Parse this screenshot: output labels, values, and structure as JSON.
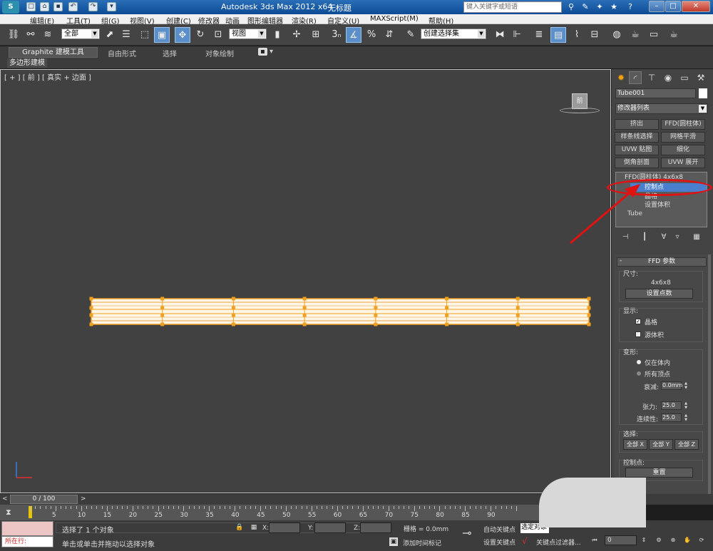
{
  "titlebar": {
    "app_title": "Autodesk 3ds Max  2012 x64",
    "file_name": "无标题",
    "search_placeholder": "键入关键字或短语",
    "logo_text": "S"
  },
  "menu": [
    "编辑(E)",
    "工具(T)",
    "组(G)",
    "视图(V)",
    "创建(C)",
    "修改器",
    "动画",
    "图形编辑器",
    "渲染(R)",
    "自定义(U)",
    "MAXScript(M)",
    "帮助(H)"
  ],
  "toolbar": {
    "selection_filter": "全部",
    "ref_coord": "视图",
    "snap_count": "3",
    "named_selection": "创建选择集"
  },
  "ribbon": {
    "tabs": [
      "Graphite 建模工具",
      "自由形式",
      "选择",
      "对象绘制"
    ],
    "sub_label": "多边形建模"
  },
  "viewport": {
    "label": "[ + ] [ 前 ] [ 真实 + 边面 ]",
    "viewcube_label": "前",
    "accent_color": "#f0a020"
  },
  "command_panel": {
    "object_name": "Tube001",
    "modifier_list": "修改器列表",
    "modifier_buttons": [
      "挤出",
      "FFD(圆柱体)",
      "样条线选择",
      "网格平滑",
      "UVW 贴图",
      "细化",
      "倒角剖面",
      "UVW 展开"
    ],
    "stack": {
      "modifier": "FFD(圆柱体) 4x6x8",
      "sub_items": [
        "控制点",
        "晶格",
        "设置体积"
      ],
      "base": "Tube",
      "selected": "控制点"
    }
  },
  "ffd_params": {
    "title": "FFD 参数",
    "dimensions_label": "尺寸:",
    "dimensions_value": "4x6x8",
    "set_points_button": "设置点数",
    "display_label": "显示:",
    "lattice": "晶格",
    "lattice_checked": true,
    "source_volume": "源体积",
    "source_volume_checked": false,
    "deform_label": "变形:",
    "only_in_volume": "仅在体内",
    "all_vertices": "所有顶点",
    "falloff_label": "衰减:",
    "falloff_value": "0.0mm",
    "tension_label": "张力:",
    "tension_value": "25.0",
    "continuity_label": "连续性:",
    "continuity_value": "25.0",
    "selection_label": "选择:",
    "select_x": "全部 X",
    "select_y": "全部 Y",
    "select_z": "全部 Z",
    "control_points_label": "控制点:",
    "reset_button": "重置"
  },
  "timeline": {
    "frame_display": "0 / 100",
    "ticks": [
      5,
      10,
      15,
      20,
      25,
      30,
      35,
      40,
      45,
      50,
      55,
      60,
      65,
      70,
      75,
      80,
      85,
      90
    ]
  },
  "status": {
    "now_label": "所在行:",
    "selected_text": "选择了 1 个对象",
    "hint_text": "单击或单击并拖动以选择对象",
    "x_label": "X:",
    "y_label": "Y:",
    "z_label": "Z:",
    "grid_text": "栅格 = 0.0mm",
    "add_time_tag": "添加时间标记",
    "auto_key": "自动关键点",
    "set_key": "设置关键点",
    "selected_obj": "选定对象",
    "key_filters": "关键点过滤器...",
    "frame": "0"
  }
}
